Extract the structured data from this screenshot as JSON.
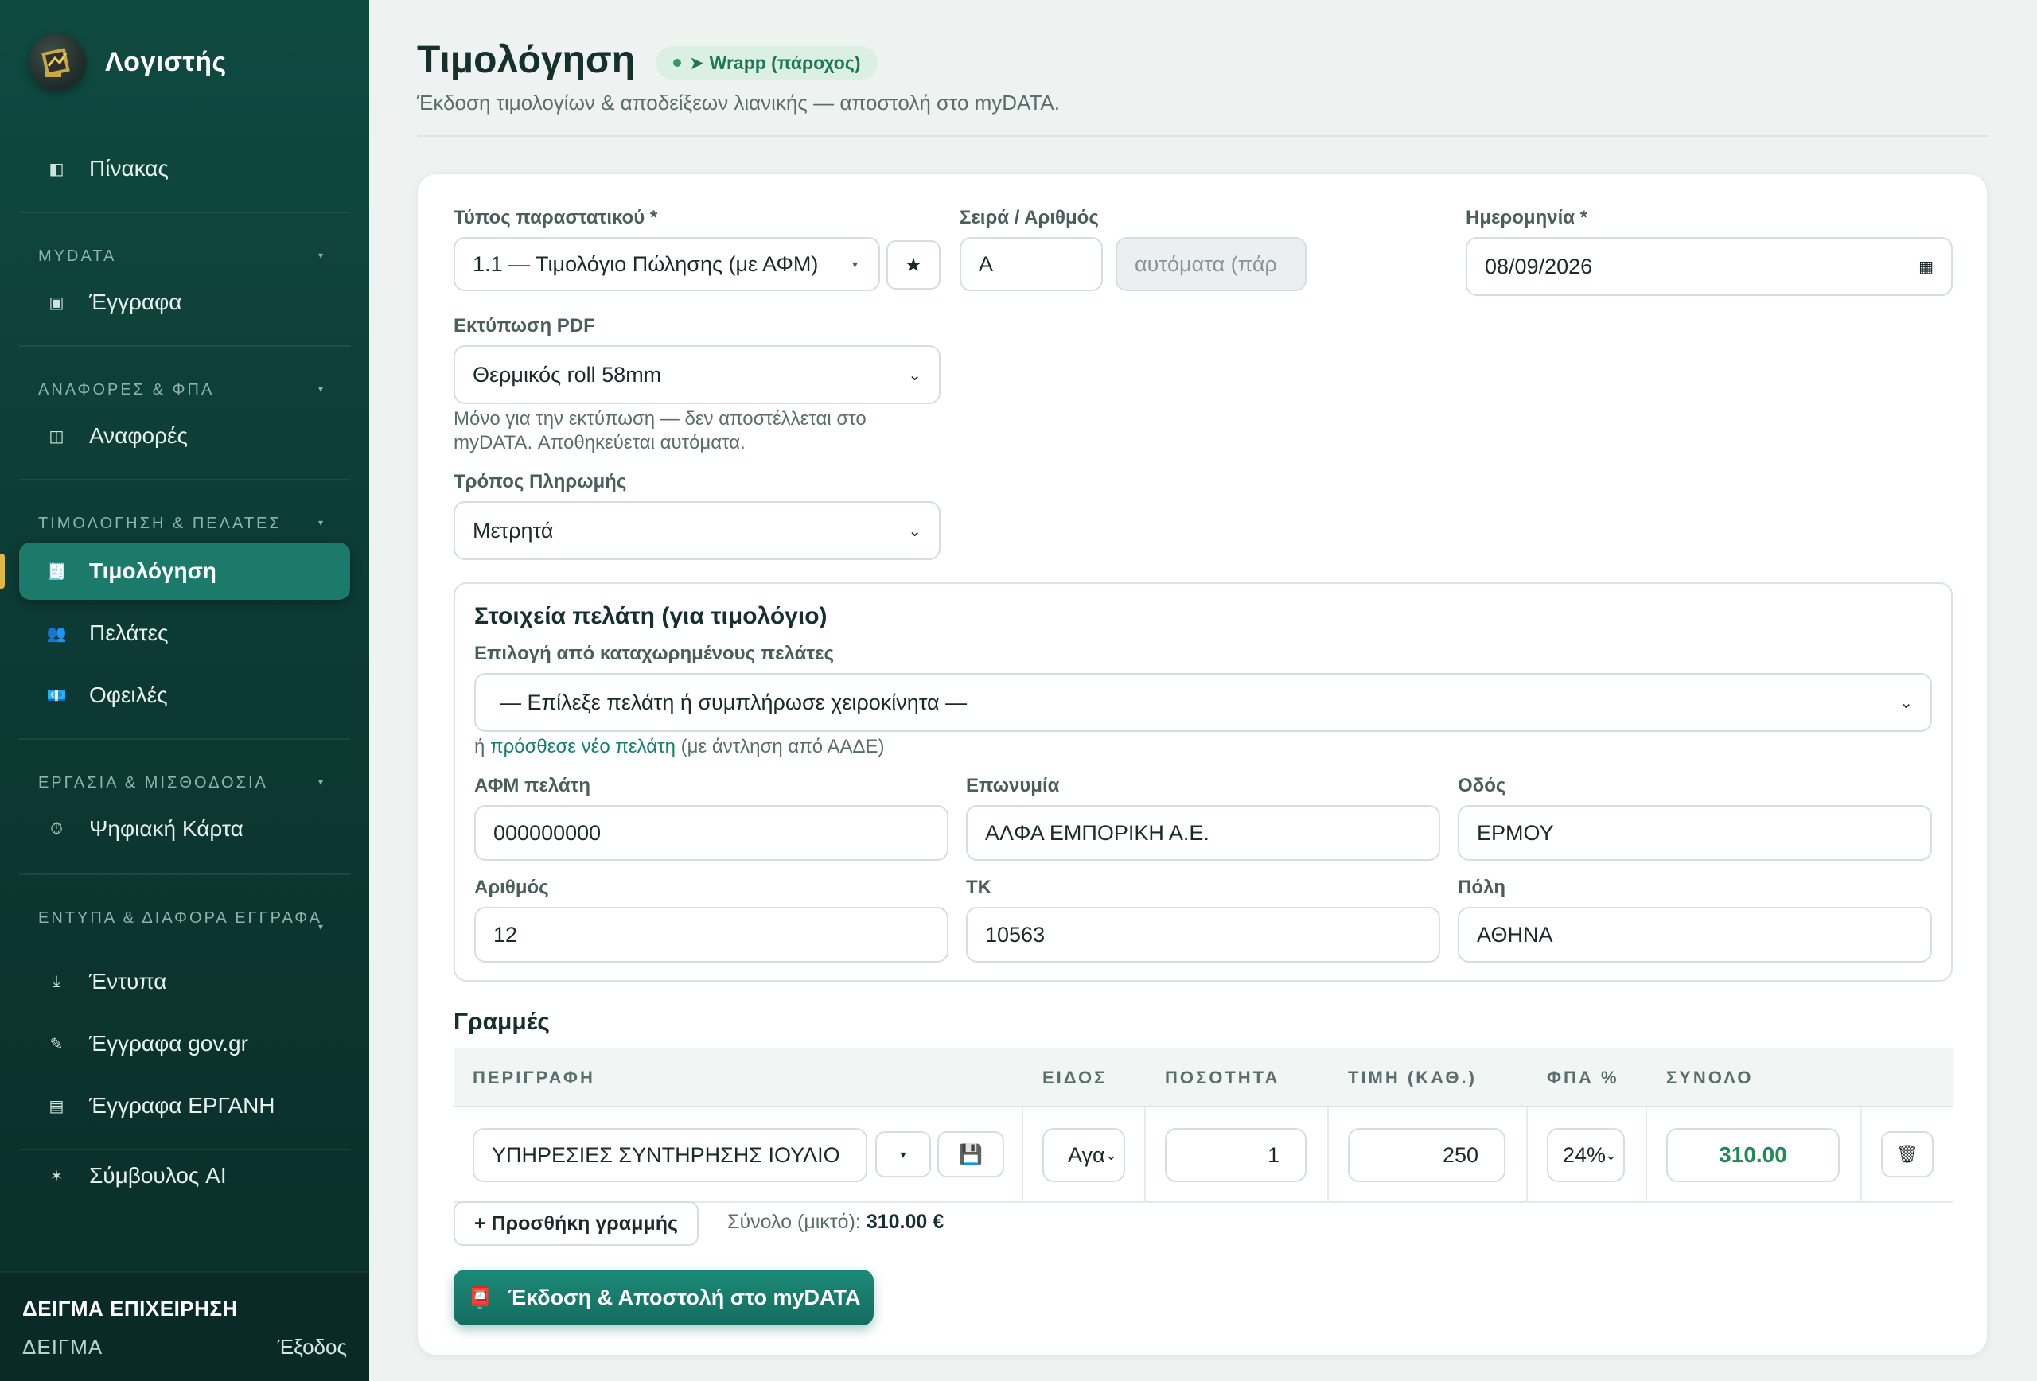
{
  "sidebar": {
    "brand": "Λογιστής",
    "dashboard": "Πίνακας",
    "groups": [
      {
        "label": "MYDATA",
        "items": [
          "Έγγραφα"
        ]
      },
      {
        "label": "ΑΝΑΦΟΡΕΣ & ΦΠΑ",
        "items": [
          "Αναφορές"
        ]
      },
      {
        "label": "ΤΙΜΟΛΟΓΗΣΗ & ΠΕΛΑΤΕΣ",
        "items": [
          "Τιμολόγηση",
          "Πελάτες",
          "Οφειλές"
        ]
      },
      {
        "label": "ΕΡΓΑΣΙΑ & ΜΙΣΘΟΔΟΣΙΑ",
        "items": [
          "Ψηφιακή Κάρτα"
        ]
      },
      {
        "label": "ΕΝΤΥΠΑ & ΔΙΑΦΟΡΑ ΕΓΓΡΑΦΑ",
        "items": [
          "Έντυπα",
          "Έγγραφα gov.gr",
          "Έγγραφα ΕΡΓΑΝΗ"
        ]
      }
    ],
    "ai_advisor": "Σύμβουλος AI",
    "business_name": "ΔΕΙΓΜΑ ΕΠΙΧΕΙΡΗΣΗ",
    "business_sub": "ΔΕΙΓΜΑ",
    "logout": "Έξοδος"
  },
  "header": {
    "title": "Τιμολόγηση",
    "provider_badge": "➤ Wrapp (πάροχος)",
    "subtitle": "Έκδοση τιμολογίων & αποδείξεων λιανικής — αποστολή στο myDATA."
  },
  "form": {
    "doc_type_label": "Τύπος παραστατικού *",
    "doc_type_value": "1.1 — Τιμολόγιο Πώλησης (με ΑΦΜ)",
    "series_label": "Σειρά / Αριθμός",
    "series_value": "A",
    "number_placeholder": "αυτόματα (πάρ",
    "date_label": "Ημερομηνία *",
    "date_value": "08/09/2026",
    "pdf_label": "Εκτύπωση PDF",
    "pdf_value": "Θερμικός roll 58mm",
    "pdf_hint": "Μόνο για την εκτύπωση — δεν αποστέλλεται στο myDATA. Αποθηκεύεται αυτόματα.",
    "payment_label": "Τρόπος Πληρωμής",
    "payment_value": "Μετρητά"
  },
  "customer": {
    "title": "Στοιχεία πελάτη (για τιμολόγιο)",
    "select_label": "Επιλογή από καταχωρημένους πελάτες",
    "select_value": "— Επίλεξε πελάτη ή συμπλήρωσε χειροκίνητα —",
    "or_text": "ή",
    "add_link": "πρόσθεσε νέο πελάτη",
    "add_suffix": "(με άντληση από ΑΑΔΕ)",
    "afm_label": "ΑΦΜ πελάτη",
    "afm_value": "000000000",
    "name_label": "Επωνυμία",
    "name_value": "ΑΛΦΑ ΕΜΠΟΡΙΚΗ Α.Ε.",
    "street_label": "Οδός",
    "street_value": "ΕΡΜΟΥ",
    "number_label": "Αριθμός",
    "number_value": "12",
    "zip_label": "ΤΚ",
    "zip_value": "10563",
    "city_label": "Πόλη",
    "city_value": "ΑΘΗΝΑ"
  },
  "lines": {
    "title": "Γραμμές",
    "headers": [
      "ΠΕΡΙΓΡΑΦΗ",
      "ΕΙΔΟΣ",
      "ΠΟΣΟΤΗΤΑ",
      "ΤΙΜΗ (ΚΑΘ.)",
      "ΦΠΑ %",
      "ΣΥΝΟΛΟ"
    ],
    "rows": [
      {
        "description": "ΥΠΗΡΕΣΙΕΣ ΣΥΝΤΗΡΗΣΗΣ ΙΟΥΛΙΟ",
        "kind": "Αγα",
        "qty": "1",
        "price": "250",
        "vat": "24%",
        "total": "310.00"
      }
    ],
    "add_line": "+ Προσθήκη γραμμής",
    "gross_label": "Σύνολο (μικτό):",
    "gross_value": "310.00 €",
    "submit": "Έκδοση & Αποστολή στο myDATA"
  },
  "colors": {
    "accent": "#1b7a6a",
    "sidebar": "#0c3a34",
    "success": "#1f8a55"
  }
}
